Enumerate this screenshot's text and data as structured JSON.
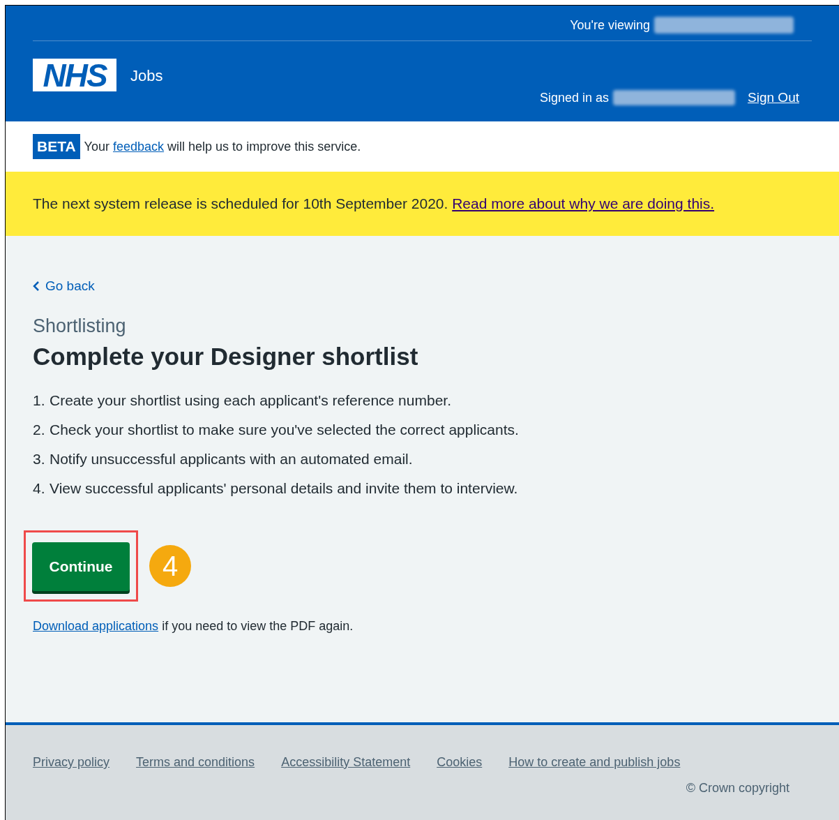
{
  "header": {
    "viewing_label": "You're viewing",
    "logo": "NHS",
    "service_name": "Jobs",
    "signed_in_label": "Signed in as",
    "sign_out": "Sign Out"
  },
  "phase_banner": {
    "tag": "BETA",
    "text_before": "Your",
    "link": "feedback",
    "text_after": "will help us to improve this service."
  },
  "notice": {
    "text": "The next system release is scheduled for 10th September 2020.",
    "link": "Read more about why we are doing this."
  },
  "back_link": "Go back",
  "caption": "Shortlisting",
  "heading": "Complete your Designer shortlist",
  "steps": [
    {
      "number": "1.",
      "text": "Create your shortlist using each applicant's reference number."
    },
    {
      "number": "2.",
      "text": "Check your shortlist to make sure you've selected the correct applicants."
    },
    {
      "number": "3.",
      "text": "Notify unsuccessful applicants with an automated email."
    },
    {
      "number": "4.",
      "text": "View successful applicants' personal details and invite them to interview."
    }
  ],
  "continue_button": {
    "label": "Continue",
    "highlighted": true
  },
  "step_marker": "4",
  "download": {
    "link": "Download applications",
    "text": "if you need to view the PDF again."
  },
  "footer": {
    "links": [
      "Privacy policy",
      "Terms and conditions",
      "Accessibility Statement",
      "Cookies",
      "How to create and publish jobs"
    ],
    "copyright": "© Crown copyright"
  }
}
